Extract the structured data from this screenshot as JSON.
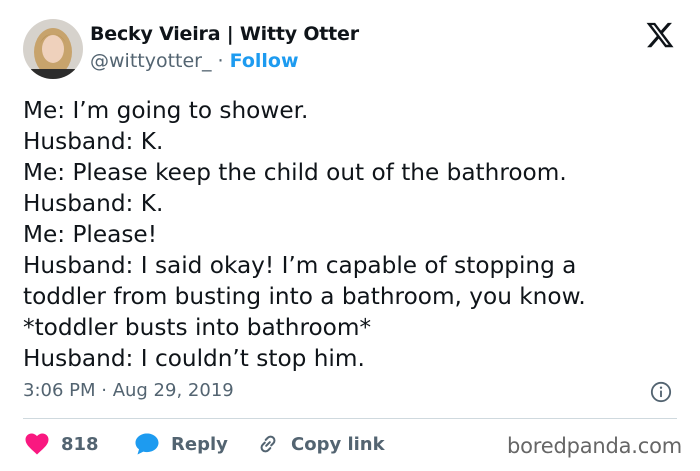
{
  "author": {
    "display_name": "Becky Vieira | Witty Otter",
    "handle": "@wittyotter_",
    "separator": " · ",
    "follow_label": "Follow"
  },
  "tweet": {
    "lines": [
      "Me: I’m going to shower.",
      "Husband: K.",
      "Me: Please keep the child out of the bathroom.",
      "Husband: K.",
      "Me: Please!",
      "Husband: I said okay! I’m capable of stopping a",
      "toddler from busting into a bathroom, you know.",
      "*toddler busts into bathroom*",
      "Husband: I couldn’t stop him."
    ],
    "timestamp": "3:06 PM · Aug 29, 2019"
  },
  "actions": {
    "like_count": "818",
    "reply_label": "Reply",
    "copy_link_label": "Copy link"
  },
  "watermark": "boredpanda.com",
  "icons": {
    "platform_logo": "x-logo-icon",
    "info": "info-icon",
    "like": "heart-icon",
    "reply": "speech-bubble-icon",
    "copy_link": "link-icon"
  },
  "colors": {
    "text": "#0f1419",
    "secondary": "#536471",
    "link": "#1d9bf0",
    "like": "#f91880",
    "reply": "#1d9bf0",
    "divider": "#cfd9de"
  }
}
